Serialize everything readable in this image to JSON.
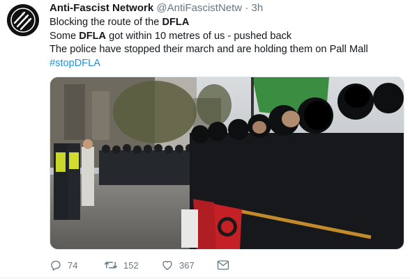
{
  "tweet": {
    "author_name": "Anti-Fascist Network",
    "handle": "@AntiFascistNetw",
    "separator": "·",
    "time": "3h",
    "lines": [
      {
        "pre": "Blocking the route of the ",
        "bold": "DFLA",
        "post": ""
      },
      {
        "pre": "Some ",
        "bold": "DFLA",
        "post": " got within 10 metres of us - pushed back"
      },
      {
        "pre": "The police have stopped their march and are holding them on Pall Mall",
        "bold": "",
        "post": ""
      }
    ],
    "hashtag": "#stopDFLA"
  },
  "actions": {
    "reply_count": "74",
    "retweet_count": "152",
    "like_count": "367"
  },
  "icons": {
    "avatar": "antifa-three-arrows-logo",
    "reply": "reply-icon",
    "retweet": "retweet-icon",
    "like": "heart-icon",
    "dm": "envelope-icon"
  },
  "colors": {
    "text": "#14171a",
    "secondary": "#657786",
    "link": "#1b95e0"
  }
}
